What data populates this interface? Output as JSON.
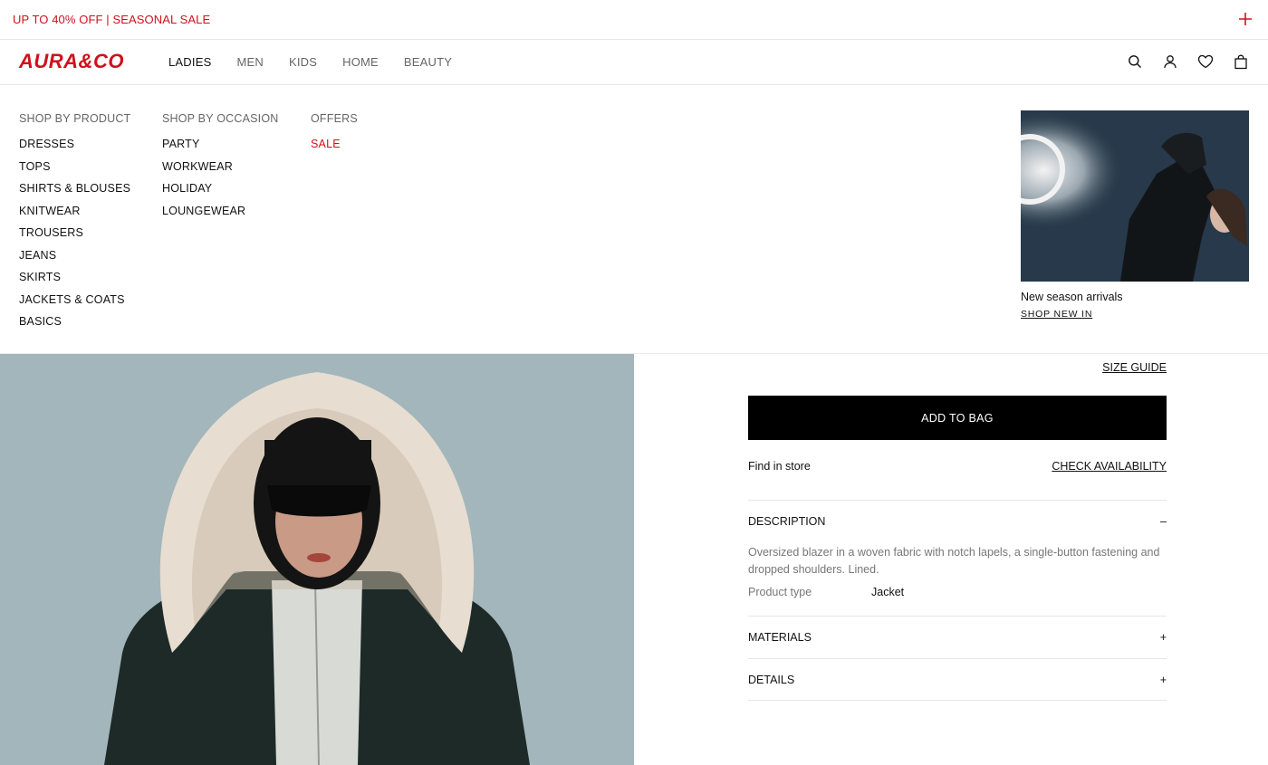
{
  "promo_bar": {
    "text": "UP TO 40% OFF | SEASONAL SALE"
  },
  "header": {
    "logo": "AURA&CO",
    "nav": [
      "LADIES",
      "MEN",
      "KIDS",
      "HOME",
      "BEAUTY"
    ],
    "active_nav": "LADIES"
  },
  "mega_menu": {
    "columns": [
      {
        "title": "SHOP BY PRODUCT",
        "links": [
          "DRESSES",
          "TOPS",
          "SHIRTS & BLOUSES",
          "KNITWEAR",
          "TROUSERS",
          "JEANS",
          "SKIRTS",
          "JACKETS & COATS",
          "BASICS"
        ]
      },
      {
        "title": "SHOP BY OCCASION",
        "links": [
          "PARTY",
          "WORKWEAR",
          "HOLIDAY",
          "LOUNGEWEAR"
        ]
      },
      {
        "title": "OFFERS",
        "links": [
          "SALE"
        ]
      }
    ],
    "promo": {
      "caption": "New season arrivals",
      "link": "SHOP NEW IN"
    }
  },
  "product": {
    "size_guide": "SIZE GUIDE",
    "add_to_bag": "ADD TO BAG",
    "find_in_store": "Find in store",
    "check_availability": "CHECK AVAILABILITY",
    "accordions": [
      {
        "title": "DESCRIPTION",
        "toggle": "–",
        "body": "Oversized blazer in a woven fabric with notch lapels, a single-button fastening and dropped shoulders. Lined.",
        "attr_key": "Product type",
        "attr_value": "Jacket"
      },
      {
        "title": "MATERIALS",
        "toggle": "+"
      },
      {
        "title": "DETAILS",
        "toggle": "+"
      }
    ]
  },
  "colors": {
    "brand": "#d0101b",
    "text": "#111111",
    "muted": "#777777",
    "button": "#000000"
  },
  "icons": [
    "plus-icon",
    "search-icon",
    "account-icon",
    "heart-icon",
    "bag-icon"
  ]
}
